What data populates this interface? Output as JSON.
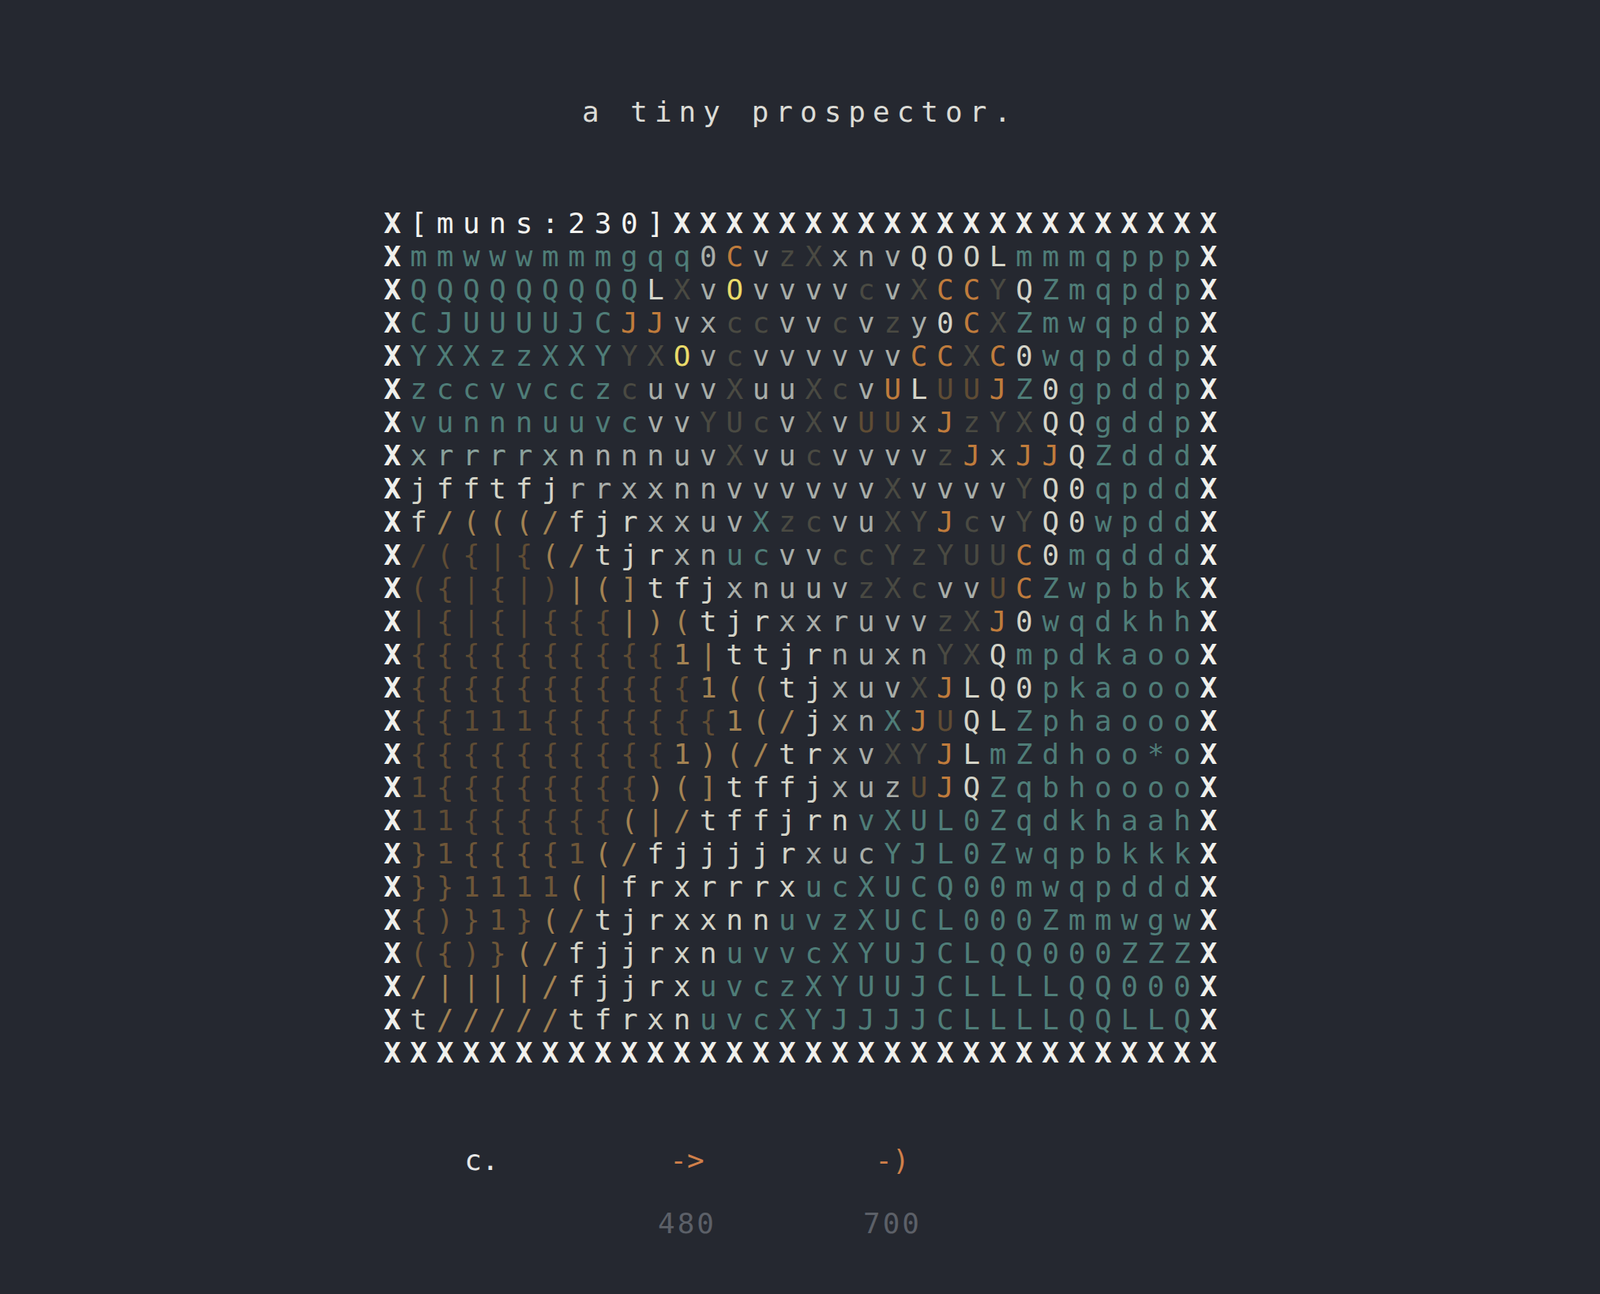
{
  "title": "a tiny prospector.",
  "board": {
    "border_char": "X",
    "header": "[muns:230]",
    "rows": [
      {
        "cells": [
          {
            "text": "mmwwwmmmgqq",
            "color": "#4f7d78"
          },
          {
            "text": "0",
            "color": "#a9aea9"
          },
          {
            "text": "C",
            "color": "#c07c3c"
          },
          {
            "text": "v",
            "color": "#a9aea9"
          },
          {
            "text": "zX",
            "color": "#4a4a42"
          },
          {
            "text": "xnv",
            "color": "#a9aea9"
          },
          {
            "text": "QOOL",
            "color": "#d4d4c8"
          },
          {
            "text": "mmmqppp",
            "color": "#4f7d78"
          }
        ]
      },
      {
        "cells": [
          {
            "text": "QQQQQQQQQ",
            "color": "#4f7d78"
          },
          {
            "text": "L",
            "color": "#d4d4c8"
          },
          {
            "text": "X",
            "color": "#4a4a42"
          },
          {
            "text": "v",
            "color": "#a9aea9"
          },
          {
            "text": "O",
            "color": "#eadb6a"
          },
          {
            "text": "vvvv",
            "color": "#a9aea9"
          },
          {
            "text": "c",
            "color": "#4a4a42"
          },
          {
            "text": "v",
            "color": "#a9aea9"
          },
          {
            "text": "X",
            "color": "#4a4a42"
          },
          {
            "text": "CC",
            "color": "#c07c3c"
          },
          {
            "text": "Y",
            "color": "#4a4a42"
          },
          {
            "text": "Q",
            "color": "#d4d4c8"
          },
          {
            "text": "Zmqpdp",
            "color": "#4f7d78"
          }
        ]
      },
      {
        "cells": [
          {
            "text": "CJUUUUJC",
            "color": "#4f7d78"
          },
          {
            "text": "JJ",
            "color": "#c07c3c"
          },
          {
            "text": "vx",
            "color": "#a9aea9"
          },
          {
            "text": "cc",
            "color": "#4a4a42"
          },
          {
            "text": "vv",
            "color": "#a9aea9"
          },
          {
            "text": "c",
            "color": "#4a4a42"
          },
          {
            "text": "v",
            "color": "#a9aea9"
          },
          {
            "text": "z",
            "color": "#4a4a42"
          },
          {
            "text": "y",
            "color": "#a9aea9"
          },
          {
            "text": "0",
            "color": "#d4d4c8"
          },
          {
            "text": "C",
            "color": "#c07c3c"
          },
          {
            "text": "X",
            "color": "#4a4a42"
          },
          {
            "text": "Zmwqpdp",
            "color": "#4f7d78"
          }
        ]
      },
      {
        "cells": [
          {
            "text": "YXXzzXXY",
            "color": "#4f7d78"
          },
          {
            "text": "YX",
            "color": "#4a4a42"
          },
          {
            "text": "O",
            "color": "#eadb6a"
          },
          {
            "text": "v",
            "color": "#a9aea9"
          },
          {
            "text": "c",
            "color": "#4a4a42"
          },
          {
            "text": "vvvvvv",
            "color": "#a9aea9"
          },
          {
            "text": "CC",
            "color": "#c07c3c"
          },
          {
            "text": "X",
            "color": "#4a4a42"
          },
          {
            "text": "C",
            "color": "#c07c3c"
          },
          {
            "text": "0",
            "color": "#d4d4c8"
          },
          {
            "text": "wqpddp",
            "color": "#4f7d78"
          }
        ]
      },
      {
        "cells": [
          {
            "text": "zccvvccz",
            "color": "#4f7d78"
          },
          {
            "text": "c",
            "color": "#4a4a42"
          },
          {
            "text": "uvv",
            "color": "#a9aea9"
          },
          {
            "text": "X",
            "color": "#4a4a42"
          },
          {
            "text": "uu",
            "color": "#a9aea9"
          },
          {
            "text": "Xc",
            "color": "#4a4a42"
          },
          {
            "text": "v",
            "color": "#a9aea9"
          },
          {
            "text": "U",
            "color": "#c07c3c"
          },
          {
            "text": "L",
            "color": "#d4d4c8"
          },
          {
            "text": "UU",
            "color": "#5f4c34"
          },
          {
            "text": "J",
            "color": "#c07c3c"
          },
          {
            "text": "Z",
            "color": "#4f7d78"
          },
          {
            "text": "0",
            "color": "#d4d4c8"
          },
          {
            "text": "gpddp",
            "color": "#4f7d78"
          }
        ]
      },
      {
        "cells": [
          {
            "text": "vunnnuuvc",
            "color": "#4f7d78"
          },
          {
            "text": "vv",
            "color": "#a9aea9"
          },
          {
            "text": "YUc",
            "color": "#4a4a42"
          },
          {
            "text": "v",
            "color": "#a9aea9"
          },
          {
            "text": "X",
            "color": "#4a4a42"
          },
          {
            "text": "v",
            "color": "#a9aea9"
          },
          {
            "text": "UU",
            "color": "#5f4c34"
          },
          {
            "text": "x",
            "color": "#a9aea9"
          },
          {
            "text": "J",
            "color": "#c07c3c"
          },
          {
            "text": "zYX",
            "color": "#4a4a42"
          },
          {
            "text": "QQ",
            "color": "#d4d4c8"
          },
          {
            "text": "gddp",
            "color": "#4f7d78"
          }
        ]
      },
      {
        "cells": [
          {
            "text": "xrrrrx",
            "color": "#8aa29c"
          },
          {
            "text": "nnnnuv",
            "color": "#a9aea9"
          },
          {
            "text": "X",
            "color": "#4a4a42"
          },
          {
            "text": "vu",
            "color": "#a9aea9"
          },
          {
            "text": "c",
            "color": "#4a4a42"
          },
          {
            "text": "vvvv",
            "color": "#a9aea9"
          },
          {
            "text": "z",
            "color": "#4a4a42"
          },
          {
            "text": "J",
            "color": "#c07c3c"
          },
          {
            "text": "x",
            "color": "#a9aea9"
          },
          {
            "text": "JJ",
            "color": "#c07c3c"
          },
          {
            "text": "Q",
            "color": "#d4d4c8"
          },
          {
            "text": "Zddd",
            "color": "#4f7d78"
          }
        ]
      },
      {
        "cells": [
          {
            "text": "jfftfj",
            "color": "#d4d4c8"
          },
          {
            "text": "rrxxnnvvvvvv",
            "color": "#a9aea9"
          },
          {
            "text": "X",
            "color": "#4a4a42"
          },
          {
            "text": "vvvv",
            "color": "#a9aea9"
          },
          {
            "text": "Y",
            "color": "#4a4a42"
          },
          {
            "text": "Q0",
            "color": "#d4d4c8"
          },
          {
            "text": "qpdd",
            "color": "#4f7d78"
          }
        ]
      },
      {
        "cells": [
          {
            "text": "f",
            "color": "#d4d4c8"
          },
          {
            "text": "/(((/",
            "color": "#a38252"
          },
          {
            "text": "fjr",
            "color": "#d4d4c8"
          },
          {
            "text": "xxuv",
            "color": "#a9aea9"
          },
          {
            "text": "X",
            "color": "#4f7d78"
          },
          {
            "text": "zc",
            "color": "#4a4a42"
          },
          {
            "text": "vu",
            "color": "#a9aea9"
          },
          {
            "text": "XY",
            "color": "#4a4a42"
          },
          {
            "text": "J",
            "color": "#c07c3c"
          },
          {
            "text": "c",
            "color": "#4a4a42"
          },
          {
            "text": "v",
            "color": "#a9aea9"
          },
          {
            "text": "Y",
            "color": "#4a4a42"
          },
          {
            "text": "Q0",
            "color": "#d4d4c8"
          },
          {
            "text": "wpdd",
            "color": "#4f7d78"
          }
        ]
      },
      {
        "cells": [
          {
            "text": "/({|{",
            "color": "#5f4c34"
          },
          {
            "text": "(/",
            "color": "#a38252"
          },
          {
            "text": "tjr",
            "color": "#d4d4c8"
          },
          {
            "text": "xn",
            "color": "#a9aea9"
          },
          {
            "text": "uc",
            "color": "#4f7d78"
          },
          {
            "text": "vv",
            "color": "#a9aea9"
          },
          {
            "text": "ccYzYUU",
            "color": "#4a4a42"
          },
          {
            "text": "C",
            "color": "#c07c3c"
          },
          {
            "text": "0",
            "color": "#d4d4c8"
          },
          {
            "text": "mqddd",
            "color": "#4f7d78"
          }
        ]
      },
      {
        "cells": [
          {
            "text": "({|{|)",
            "color": "#5f4c34"
          },
          {
            "text": "|(]",
            "color": "#a38252"
          },
          {
            "text": "tfj",
            "color": "#d4d4c8"
          },
          {
            "text": "xnuuv",
            "color": "#a9aea9"
          },
          {
            "text": "zXc",
            "color": "#4a4a42"
          },
          {
            "text": "vv",
            "color": "#a9aea9"
          },
          {
            "text": "U",
            "color": "#5f4c34"
          },
          {
            "text": "C",
            "color": "#c07c3c"
          },
          {
            "text": "Zwpbbk",
            "color": "#4f7d78"
          }
        ]
      },
      {
        "cells": [
          {
            "text": "|{|{|{{{",
            "color": "#5f4c34"
          },
          {
            "text": "|)(",
            "color": "#a38252"
          },
          {
            "text": "tjr",
            "color": "#d4d4c8"
          },
          {
            "text": "xxruvv",
            "color": "#a9aea9"
          },
          {
            "text": "zX",
            "color": "#4a4a42"
          },
          {
            "text": "J",
            "color": "#c07c3c"
          },
          {
            "text": "0",
            "color": "#d4d4c8"
          },
          {
            "text": "wqdkhh",
            "color": "#4f7d78"
          }
        ]
      },
      {
        "cells": [
          {
            "text": "{{{{{{{{{{",
            "color": "#5f4c34"
          },
          {
            "text": "1|",
            "color": "#a38252"
          },
          {
            "text": "ttjr",
            "color": "#d4d4c8"
          },
          {
            "text": "nuxn",
            "color": "#a9aea9"
          },
          {
            "text": "YX",
            "color": "#4a4a42"
          },
          {
            "text": "Q",
            "color": "#d4d4c8"
          },
          {
            "text": "mpdkaoo",
            "color": "#4f7d78"
          }
        ]
      },
      {
        "cells": [
          {
            "text": "{{{{{{{{{{{",
            "color": "#5f4c34"
          },
          {
            "text": "1((",
            "color": "#a38252"
          },
          {
            "text": "tj",
            "color": "#d4d4c8"
          },
          {
            "text": "xuv",
            "color": "#a9aea9"
          },
          {
            "text": "X",
            "color": "#4a4a42"
          },
          {
            "text": "J",
            "color": "#c07c3c"
          },
          {
            "text": "LQ0",
            "color": "#d4d4c8"
          },
          {
            "text": "pkaooo",
            "color": "#4f7d78"
          }
        ]
      },
      {
        "cells": [
          {
            "text": "{{111{{{{{{{",
            "color": "#5f4c34"
          },
          {
            "text": "1(/",
            "color": "#a38252"
          },
          {
            "text": "j",
            "color": "#d4d4c8"
          },
          {
            "text": "xn",
            "color": "#a9aea9"
          },
          {
            "text": "X",
            "color": "#4f7d78"
          },
          {
            "text": "J",
            "color": "#c07c3c"
          },
          {
            "text": "U",
            "color": "#5f4c34"
          },
          {
            "text": "QL",
            "color": "#d4d4c8"
          },
          {
            "text": "Zphaooo",
            "color": "#4f7d78"
          }
        ]
      },
      {
        "cells": [
          {
            "text": "{{{{{{{{{{",
            "color": "#5f4c34"
          },
          {
            "text": "1)(/",
            "color": "#a38252"
          },
          {
            "text": "tr",
            "color": "#d4d4c8"
          },
          {
            "text": "xv",
            "color": "#a9aea9"
          },
          {
            "text": "XY",
            "color": "#4a4a42"
          },
          {
            "text": "J",
            "color": "#c07c3c"
          },
          {
            "text": "L",
            "color": "#d4d4c8"
          },
          {
            "text": "mZdhoo*o",
            "color": "#4f7d78"
          }
        ]
      },
      {
        "cells": [
          {
            "text": "1{{{{{{{{",
            "color": "#5f4c34"
          },
          {
            "text": ")(]",
            "color": "#a38252"
          },
          {
            "text": "tffj",
            "color": "#d4d4c8"
          },
          {
            "text": "xuz",
            "color": "#a9aea9"
          },
          {
            "text": "U",
            "color": "#5f4c34"
          },
          {
            "text": "J",
            "color": "#c07c3c"
          },
          {
            "text": "Q",
            "color": "#d4d4c8"
          },
          {
            "text": "Zqbhoooo",
            "color": "#4f7d78"
          }
        ]
      },
      {
        "cells": [
          {
            "text": "11{{{{{{",
            "color": "#5f4c34"
          },
          {
            "text": "(|/",
            "color": "#a38252"
          },
          {
            "text": "tffjrn",
            "color": "#d4d4c8"
          },
          {
            "text": "vXUL0Zqdkhaah",
            "color": "#4f7d78"
          }
        ]
      },
      {
        "cells": [
          {
            "text": "}1{{{{1",
            "color": "#6e5638"
          },
          {
            "text": "(/",
            "color": "#a38252"
          },
          {
            "text": "fjjjjr",
            "color": "#d4d4c8"
          },
          {
            "text": "xuc",
            "color": "#a9aea9"
          },
          {
            "text": "YJL0Zwqpbkkk",
            "color": "#4f7d78"
          }
        ]
      },
      {
        "cells": [
          {
            "text": "}}1111",
            "color": "#6e5638"
          },
          {
            "text": "(|",
            "color": "#a38252"
          },
          {
            "text": "frxrrrx",
            "color": "#d4d4c8"
          },
          {
            "text": "ucXUCQ00mwqpddd",
            "color": "#4f7d78"
          }
        ]
      },
      {
        "cells": [
          {
            "text": "{)}1}",
            "color": "#6e5638"
          },
          {
            "text": "(/",
            "color": "#a38252"
          },
          {
            "text": "tjrxxnn",
            "color": "#d4d4c8"
          },
          {
            "text": "uvzXUCL000Zmmwgw",
            "color": "#4f7d78"
          }
        ]
      },
      {
        "cells": [
          {
            "text": "({)}",
            "color": "#6e5638"
          },
          {
            "text": "(/",
            "color": "#a38252"
          },
          {
            "text": "fjjrxn",
            "color": "#d4d4c8"
          },
          {
            "text": "uvvcXYUJCLQQ000ZZZ",
            "color": "#4f7d78"
          }
        ]
      },
      {
        "cells": [
          {
            "text": "/||||/",
            "color": "#a38252"
          },
          {
            "text": "fjjrx",
            "color": "#d4d4c8"
          },
          {
            "text": "uvczXYUUJCLLLLQQ000",
            "color": "#4f7d78"
          }
        ]
      },
      {
        "cells": [
          {
            "text": "t",
            "color": "#d4d4c8"
          },
          {
            "text": "/////",
            "color": "#a38252"
          },
          {
            "text": "tfrxn",
            "color": "#d4d4c8"
          },
          {
            "text": "uvcXYJJJJCLLLLQQLLQ",
            "color": "#4f7d78"
          }
        ]
      }
    ]
  },
  "actions": [
    {
      "label": "c.",
      "color": "#e8e8e8"
    },
    {
      "label": "->",
      "price": "480",
      "color": "#d0804a"
    },
    {
      "label": "-)",
      "price": "700",
      "color": "#d0804a"
    }
  ]
}
